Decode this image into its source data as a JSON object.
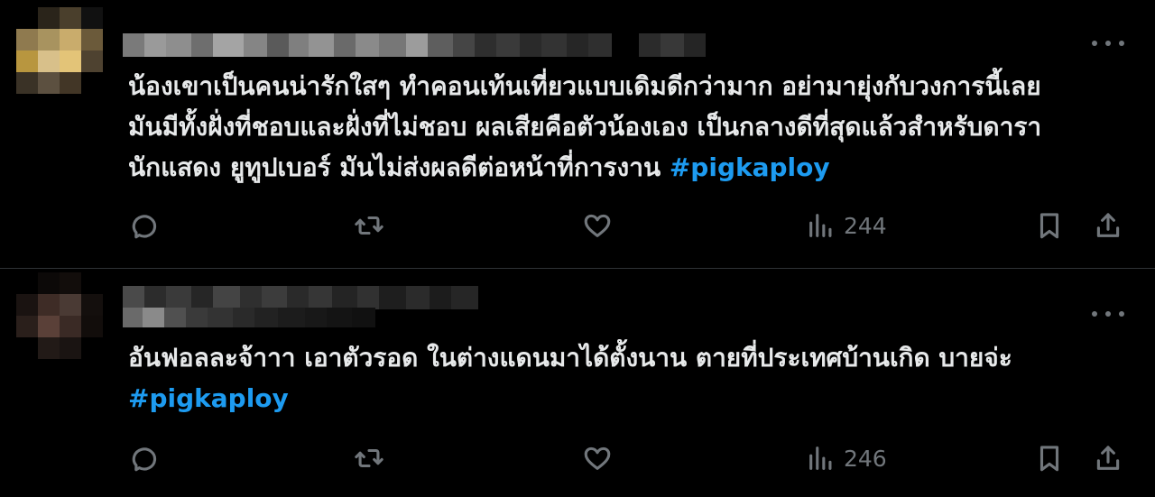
{
  "tweets": [
    {
      "text_lines": [
        "น้องเขาเป็นคนน่ารักใสๆ ทำคอนเท้นเที่ยวแบบเดิมดีกว่ามาก อย่ามายุ่งกับวงการนี้เลย",
        "มันมีทั้งฝั่งที่ชอบและฝั่งที่ไม่ชอบ ผลเสียคือตัวน้องเอง เป็นกลางดีที่สุดแล้วสำหรับดารา",
        "นักแสดง ยูทูปเบอร์ มันไม่ส่งผลดีต่อหน้าที่การงาน"
      ],
      "hashtag": "#pigkaploy",
      "views": "244"
    },
    {
      "text_lines": [
        "อันฟอลละจ้าาา เอาตัวรอด ในต่างแดนมาได้ตั้งนาน ตายที่ประเทศบ้านเกิด บายจ่ะ"
      ],
      "hashtag": "#pigkaploy",
      "views": "246"
    }
  ],
  "colors": {
    "background": "#000000",
    "text": "#e7e9ea",
    "muted": "#71767b",
    "hashtag": "#1d9bf0",
    "divider": "#2f3336"
  },
  "icons": [
    "reply-icon",
    "repost-icon",
    "like-icon",
    "views-icon",
    "bookmark-icon",
    "share-icon",
    "more-icon"
  ]
}
